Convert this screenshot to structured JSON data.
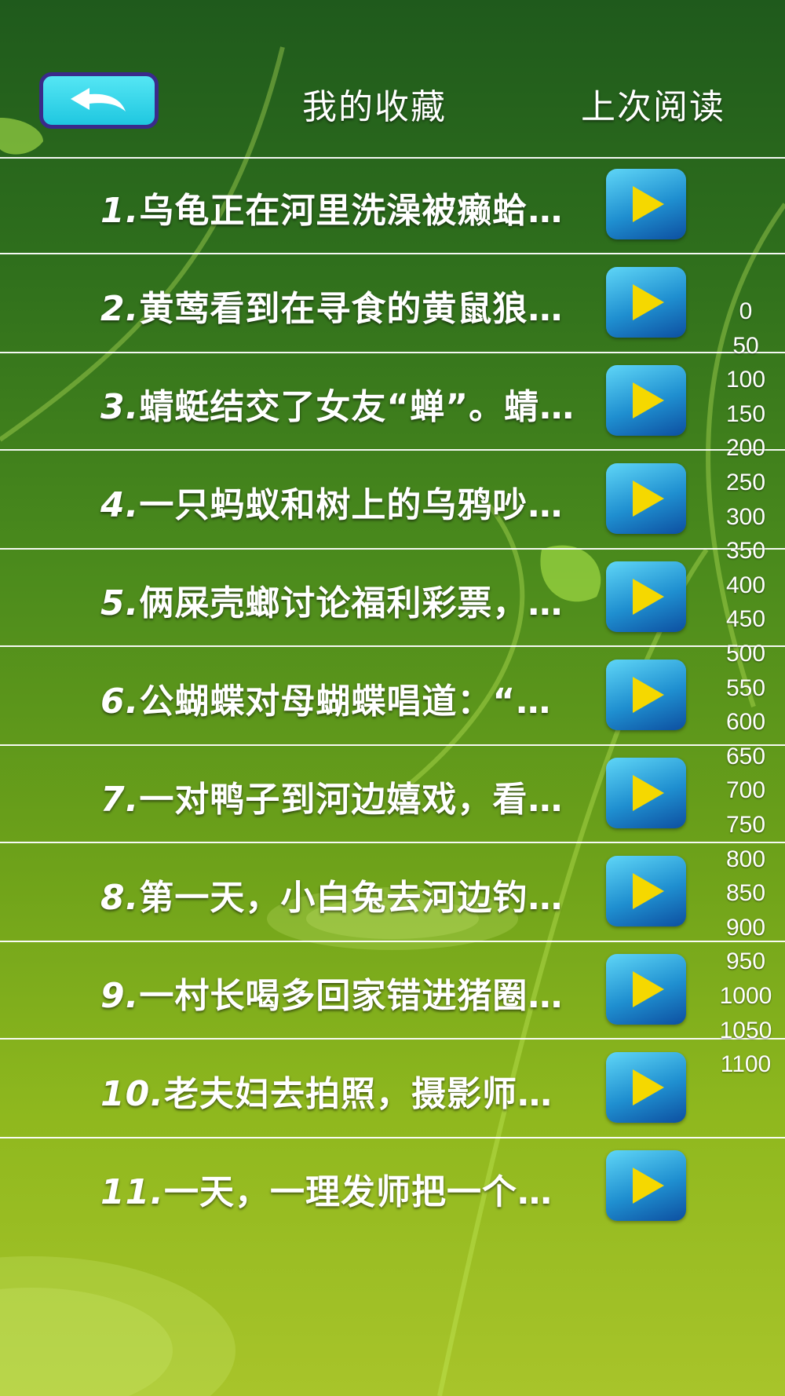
{
  "header": {
    "back_icon": "back-arrow-icon",
    "favorites_label": "我的收藏",
    "last_read_label": "上次阅读"
  },
  "items": [
    {
      "num": "1.",
      "text": "乌龟正在河里洗澡被癞蛤…"
    },
    {
      "num": "2.",
      "text": "黄莺看到在寻食的黄鼠狼…"
    },
    {
      "num": "3.",
      "text": "蜻蜓结交了女友“蝉”。蜻…"
    },
    {
      "num": "4.",
      "text": "一只蚂蚁和树上的乌鸦吵…"
    },
    {
      "num": "5.",
      "text": "俩屎壳螂讨论福利彩票，…"
    },
    {
      "num": "6.",
      "text": "公蝴蝶对母蝴蝶唱道：“…"
    },
    {
      "num": "7.",
      "text": "一对鸭子到河边嬉戏，看…"
    },
    {
      "num": "8.",
      "text": "第一天，小白兔去河边钓…"
    },
    {
      "num": "9.",
      "text": "一村长喝多回家错进猪圈…"
    },
    {
      "num": "10.",
      "text": "老夫妇去拍照，摄影师…"
    },
    {
      "num": "11.",
      "text": "一天，一理发师把一个…"
    }
  ],
  "scale_labels": [
    "0",
    "50",
    "100",
    "150",
    "200",
    "250",
    "300",
    "350",
    "400",
    "450",
    "500",
    "550",
    "600",
    "650",
    "700",
    "750",
    "800",
    "850",
    "900",
    "950",
    "1000",
    "1050",
    "1100"
  ],
  "colors": {
    "play_button": "#1f8fd0",
    "play_arrow": "#f5d800",
    "back_button": "#1fc7e0"
  }
}
